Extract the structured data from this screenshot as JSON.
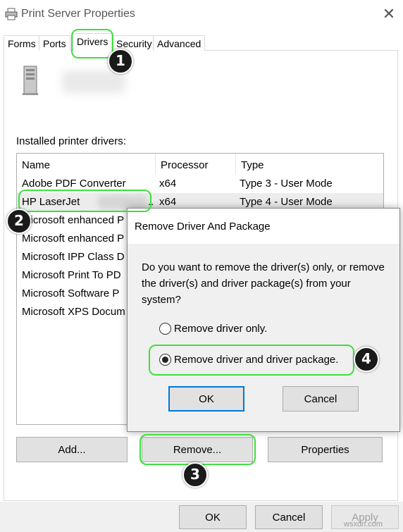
{
  "window": {
    "title": "Print Server Properties",
    "close_glyph": "✕"
  },
  "tabs": [
    {
      "label": "Forms"
    },
    {
      "label": "Ports"
    },
    {
      "label": "Drivers"
    },
    {
      "label": "Security"
    },
    {
      "label": "Advanced"
    }
  ],
  "installed_label": "Installed printer drivers:",
  "columns": {
    "name": "Name",
    "processor": "Processor",
    "type": "Type"
  },
  "drivers": [
    {
      "name": "Adobe PDF Converter",
      "processor": "x64",
      "type": "Type 3 - User Mode"
    },
    {
      "name": "HP LaserJet",
      "suffix": "..",
      "processor": "x64",
      "type": "Type 4 - User Mode"
    },
    {
      "name": "Microsoft enhanced P",
      "processor": "",
      "type": ""
    },
    {
      "name": "Microsoft enhanced P",
      "processor": "",
      "type": ""
    },
    {
      "name": "Microsoft IPP Class D",
      "processor": "",
      "type": ""
    },
    {
      "name": "Microsoft Print To PD",
      "processor": "",
      "type": ""
    },
    {
      "name": "Microsoft Software P",
      "processor": "",
      "type": ""
    },
    {
      "name": "Microsoft XPS Docum",
      "processor": "",
      "type": ""
    }
  ],
  "actions": {
    "add": "Add...",
    "remove": "Remove...",
    "properties": "Properties"
  },
  "dialog": {
    "title": "Remove Driver And Package",
    "question": "Do you want to remove the driver(s) only, or remove the driver(s) and driver package(s) from your system?",
    "option_driver_only": "Remove driver only.",
    "option_driver_package": "Remove driver and driver package.",
    "ok": "OK",
    "cancel": "Cancel"
  },
  "footer": {
    "ok": "OK",
    "cancel": "Cancel",
    "apply": "Apply"
  },
  "steps": [
    "1",
    "2",
    "3",
    "4"
  ],
  "watermark": "wsxdn.com",
  "colors": {
    "highlight": "#3de03d",
    "accent": "#0078d7",
    "selected_row": "#ececec"
  }
}
